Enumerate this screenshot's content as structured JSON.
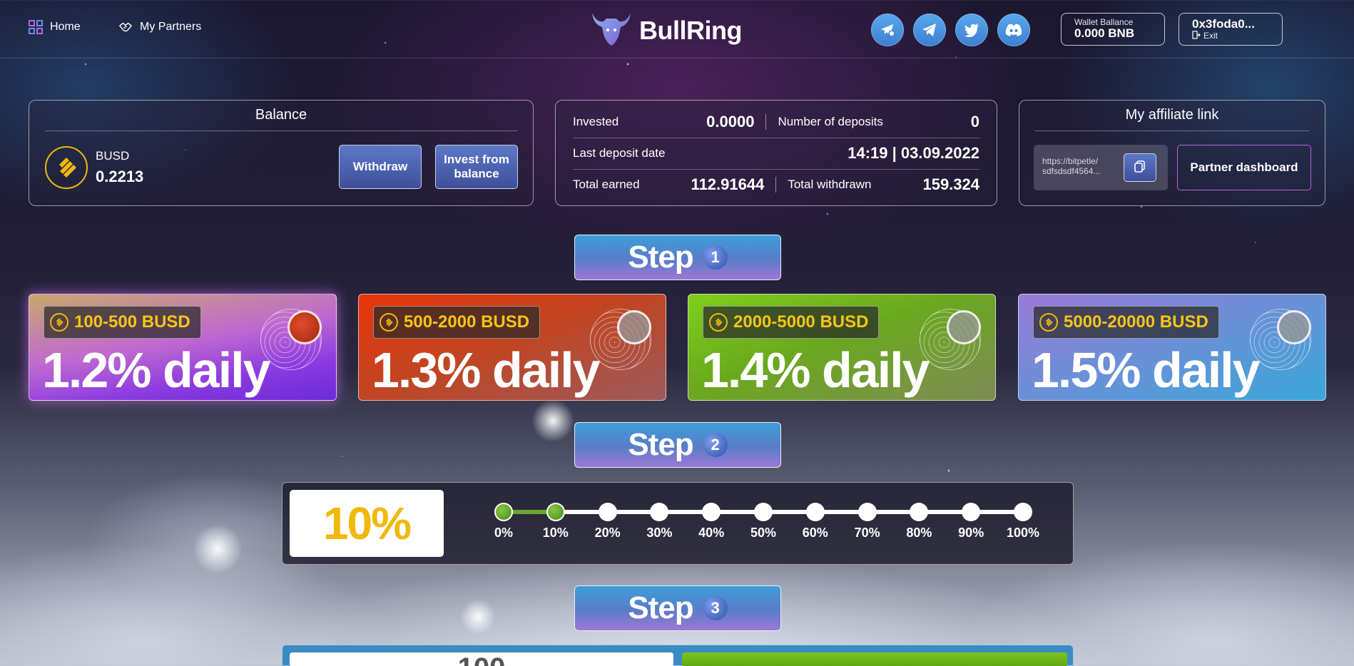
{
  "nav": {
    "home_label": "Home",
    "partners_label": "My Partners",
    "home_icon": "grid-icon",
    "partners_icon": "handshake-icon"
  },
  "brand": {
    "name": "BullRing",
    "logo_icon": "bull-icon"
  },
  "social": [
    "telegram-chat-icon",
    "telegram-icon",
    "twitter-icon",
    "discord-icon"
  ],
  "wallet": {
    "label": "Wallet Ballance",
    "value": "0.000 BNB",
    "address": "0x3foda0...",
    "exit_label": "Exit"
  },
  "balance": {
    "title": "Balance",
    "currency": "BUSD",
    "amount": "0.2213",
    "withdraw_label": "Withdraw",
    "invest_label": "Invest from balance"
  },
  "stats": {
    "invested_label": "Invested",
    "invested_value": "0.0000",
    "deposits_label": "Number of deposits",
    "deposits_value": "0",
    "last_deposit_label": "Last deposit date",
    "last_deposit_value": "14:19 | 03.09.2022",
    "earned_label": "Total earned",
    "earned_value": "112.91644",
    "withdrawn_label": "Total withdrawn",
    "withdrawn_value": "159.324"
  },
  "affiliate": {
    "title": "My affiliate link",
    "link_text": "https://bitpetle/ sdfsdsdf4564...",
    "dashboard_label": "Partner dashboard"
  },
  "steps": [
    {
      "label": "Step",
      "number": "1"
    },
    {
      "label": "Step",
      "number": "2"
    },
    {
      "label": "Step",
      "number": "3"
    }
  ],
  "plans": [
    {
      "range": "100-500 BUSD",
      "rate": "1.2% daily",
      "selected": true
    },
    {
      "range": "500-2000 BUSD",
      "rate": "1.3% daily",
      "selected": false
    },
    {
      "range": "2000-5000 BUSD",
      "rate": "1.4% daily",
      "selected": false
    },
    {
      "range": "5000-20000 BUSD",
      "rate": "1.5% daily",
      "selected": false
    }
  ],
  "reinvest": {
    "value": "10%",
    "selected_percent": 10,
    "ticks": [
      "0%",
      "10%",
      "20%",
      "30%",
      "40%",
      "50%",
      "60%",
      "70%",
      "80%",
      "90%",
      "100%"
    ]
  },
  "amount_partial": "100",
  "colors": {
    "accent_gold": "#f0b90b",
    "step_blue": "#3c9ed8",
    "slider_green": "#6aa832"
  }
}
